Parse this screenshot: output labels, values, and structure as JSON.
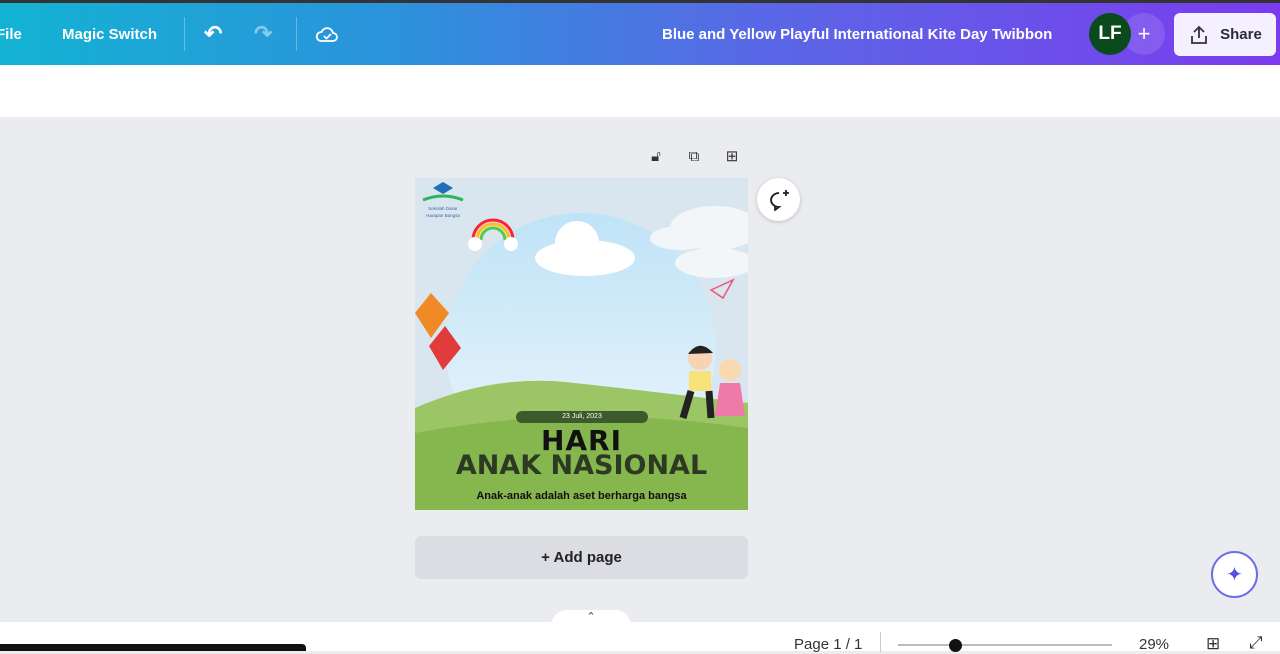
{
  "toolbar": {
    "file_label": "File",
    "magic_switch_label": "Magic Switch",
    "title": "Blue and Yellow Playful International Kite Day Twibbon",
    "avatar_initials": "LF",
    "add_label": "+",
    "share_label": "Share"
  },
  "design": {
    "logo_text": "Sekolah Dasar Harapan Bangsa",
    "date": "23 Juli, 2023",
    "title_line1": "HARI",
    "title_line2": "ANAK NASIONAL",
    "tagline": "Anak-anak adalah aset berharga bangsa"
  },
  "canvas": {
    "add_page_label": "+ Add page"
  },
  "footer": {
    "page_label": "Page 1 / 1",
    "zoom": "29%",
    "zoom_value": 29
  }
}
